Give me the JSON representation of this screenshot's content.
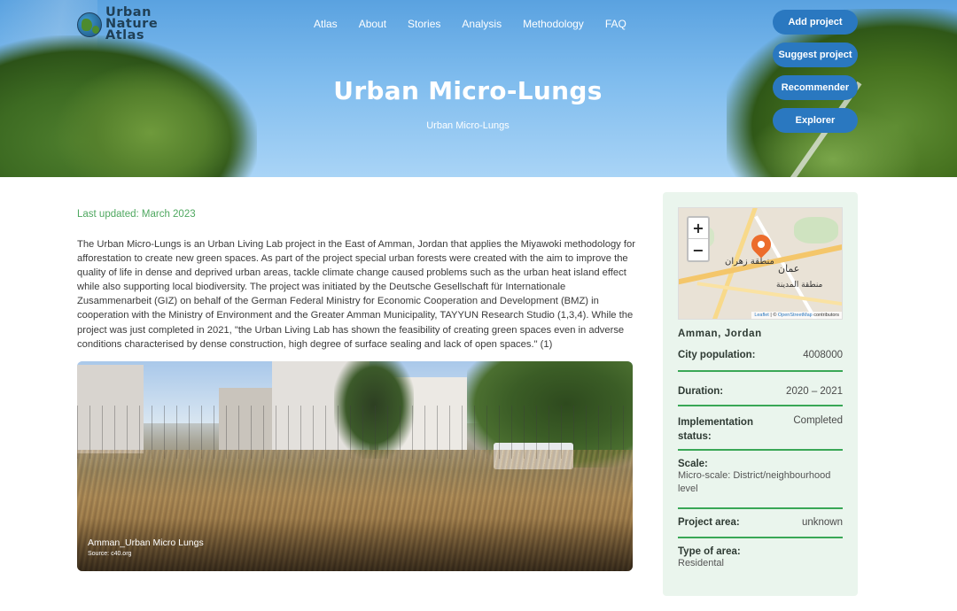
{
  "logo": {
    "line1": "Urban",
    "line2": "Nature",
    "line3": "Atlas"
  },
  "nav": {
    "items": [
      "Atlas",
      "About",
      "Stories",
      "Analysis",
      "Methodology",
      "FAQ"
    ]
  },
  "hero_buttons": [
    "Add project",
    "Suggest project",
    "Recommender",
    "Explorer"
  ],
  "hero": {
    "title": "Urban Micro-Lungs",
    "subtitle": "Urban Micro-Lungs"
  },
  "main": {
    "last_updated": "Last updated: March 2023",
    "description": "The Urban Micro-Lungs is an Urban Living Lab project in the East of Amman, Jordan that applies the Miyawoki methodology for afforestation to create new green spaces. As part of the project special urban forests were created with the aim to improve the quality of life in dense and deprived urban areas, tackle climate change caused problems such as the urban heat island effect while also supporting local biodiversity. The project was initiated by the Deutsche Gesellschaft für Internationale Zusammenarbeit (GIZ) on behalf of the German Federal Ministry for Economic Cooperation and Development (BMZ) in cooperation with the Ministry of Environment and the Greater Amman Municipality, TAYYUN Research Studio (1,3,4). While the project was just completed in 2021, \"the Urban Living Lab has shown the feasibility of creating green spaces even in adverse conditions characterised by dense construction, high degree of surface sealing and lack of open spaces.\" (1)",
    "photo": {
      "caption": "Amman_Urban Micro Lungs",
      "source": "Source: c40.org"
    }
  },
  "map": {
    "zoom_in": "+",
    "zoom_out": "−",
    "label_zahran": "منطقة زهران",
    "label_amman": "عمان",
    "label_madina": "منطقة المدينة",
    "attribution_leaflet": "Leaflet",
    "attribution_rest": " | © ",
    "attribution_osm": "OpenStreetMap",
    "attribution_end": " contributors",
    "pin_color": "#ec6c2c"
  },
  "sidebar": {
    "city": "Amman, Jordan",
    "population_label": "City population:",
    "population_value": "4008000",
    "duration_label": "Duration:",
    "duration_value": "2020 – 2021",
    "status_label": "Implementation status:",
    "status_value": "Completed",
    "scale_label": "Scale:",
    "scale_value": "Micro-scale: District/neighbourhood level",
    "area_label": "Project area:",
    "area_value": "unknown",
    "type_label": "Type of area:",
    "type_value": "Residental"
  },
  "colors": {
    "accent_green": "#39a756",
    "button_blue": "#2a78c0",
    "sidebar_bg": "#eaf5ed"
  }
}
